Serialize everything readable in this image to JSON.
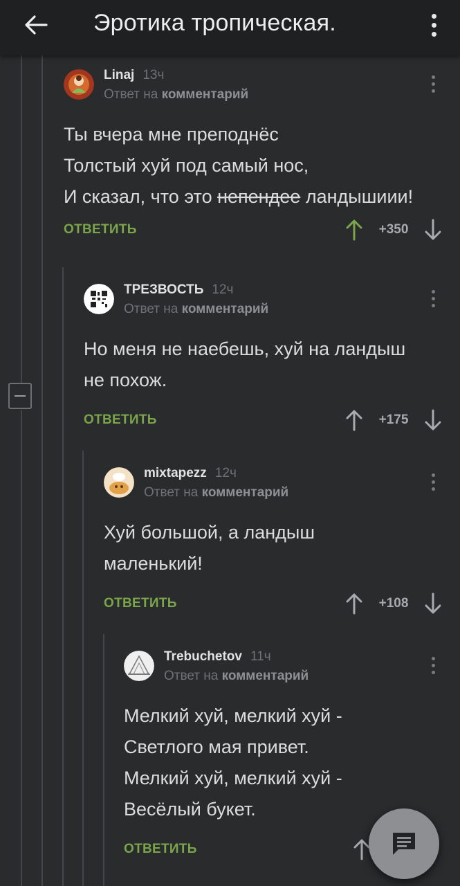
{
  "header": {
    "title": "Эротика тропическая."
  },
  "icons": {
    "back": "arrow-left-icon",
    "menu": "more-vertical-icon",
    "comment_fab": "comment-icon"
  },
  "colors": {
    "background": "#2a2b2d",
    "reply_green": "#7aa54a",
    "upvote_green": "#7aa54a"
  },
  "comments": [
    {
      "author": "Linaj",
      "time": "13ч",
      "reply_prefix": "Ответ на",
      "reply_link": "комментарий",
      "lines": [
        "Ты вчера мне преподнёс",
        "Толстый хуй под самый нос,"
      ],
      "line3_before": "И сказал, что это ",
      "line3_strike": "непендее",
      "line3_after": " ландышиии!",
      "reply_label": "ОТВЕТИТЬ",
      "score": "+350",
      "upvoted": true
    },
    {
      "author": "ТРЕЗВОСТЬ",
      "time": "12ч",
      "reply_prefix": "Ответ на",
      "reply_link": "комментарий",
      "lines": [
        "Но меня не наебешь, хуй на ландыш",
        "не похож."
      ],
      "reply_label": "ОТВЕТИТЬ",
      "score": "+175",
      "upvoted": false
    },
    {
      "author": "mixtapezz",
      "time": "12ч",
      "reply_prefix": "Ответ на",
      "reply_link": "комментарий",
      "lines": [
        "Хуй большой, а ландыш",
        "маленький!"
      ],
      "reply_label": "ОТВЕТИТЬ",
      "score": "+108",
      "upvoted": false
    },
    {
      "author": "Trebuchetov",
      "time": "11ч",
      "reply_prefix": "Ответ на",
      "reply_link": "комментарий",
      "lines": [
        "Мелкий хуй, мелкий хуй -",
        "Светлого мая привет.",
        "Мелкий хуй, мелкий хуй -",
        "Весёлый букет."
      ],
      "reply_label": "ОТВЕТИТЬ",
      "upvoted": false
    }
  ]
}
